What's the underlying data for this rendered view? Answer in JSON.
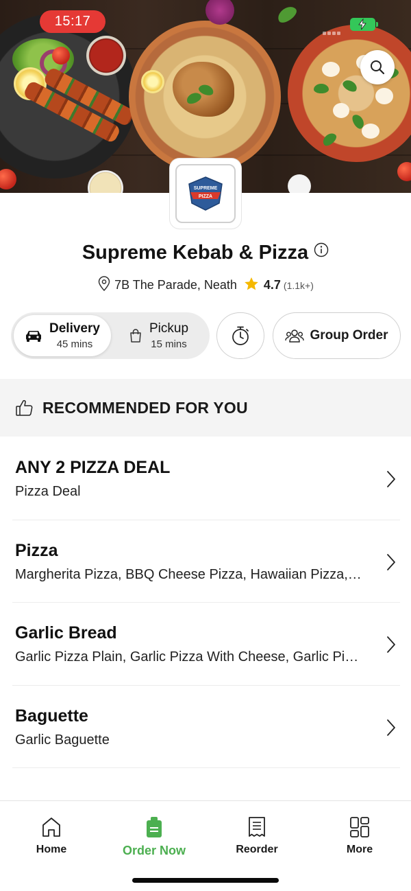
{
  "status_bar": {
    "time": "15:17",
    "battery_color": "#34c759",
    "time_pill_color": "#e53935"
  },
  "hero": {
    "search_icon": "search-icon"
  },
  "restaurant": {
    "logo_text_top": "SUPREME",
    "logo_text_bottom": "PIZZA",
    "name": "Supreme Kebab & Pizza",
    "address": "7B The Parade, Neath",
    "rating": "4.7",
    "rating_count": "(1.1k+)"
  },
  "order_modes": {
    "delivery": {
      "label": "Delivery",
      "time": "45 mins"
    },
    "pickup": {
      "label": "Pickup",
      "time": "15 mins"
    },
    "group_order_label": "Group Order"
  },
  "recommended": {
    "title": "RECOMMENDED FOR YOU"
  },
  "menu": [
    {
      "title": "ANY 2 PIZZA DEAL",
      "description": "Pizza Deal"
    },
    {
      "title": "Pizza",
      "description": "Margherita Pizza, BBQ Cheese Pizza, Hawaiian Pizza,…"
    },
    {
      "title": "Garlic Bread",
      "description": "Garlic Pizza Plain, Garlic Pizza With Cheese, Garlic Piz…"
    },
    {
      "title": "Baguette",
      "description": "Garlic Baguette"
    }
  ],
  "bottom_nav": [
    {
      "label": "Home",
      "icon": "home-icon"
    },
    {
      "label": "Order Now",
      "icon": "order-bag-icon"
    },
    {
      "label": "Reorder",
      "icon": "receipt-icon"
    },
    {
      "label": "More",
      "icon": "grid-icon"
    }
  ],
  "colors": {
    "accent_green": "#4caf50",
    "star": "#f5b800",
    "text": "#111111"
  }
}
